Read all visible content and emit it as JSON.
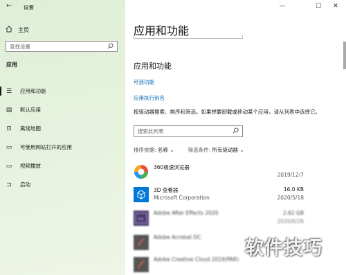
{
  "window": {
    "title": "设置",
    "minimize": "—",
    "maximize": "☐",
    "close": "✕"
  },
  "sidebar": {
    "home_label": "主页",
    "search_placeholder": "查找设置",
    "section_title": "应用",
    "items": [
      {
        "label": "应用和功能",
        "icon": "apps-list-icon"
      },
      {
        "label": "默认应用",
        "icon": "default-apps-icon"
      },
      {
        "label": "离线地图",
        "icon": "offline-map-icon"
      },
      {
        "label": "可使用网站打开的应用",
        "icon": "website-app-icon"
      },
      {
        "label": "视频播放",
        "icon": "video-icon"
      },
      {
        "label": "启动",
        "icon": "startup-icon"
      }
    ]
  },
  "main": {
    "page_title": "应用和功能",
    "section_title": "应用和功能",
    "link_optional": "可选功能",
    "link_aliases": "应用执行别名",
    "description": "按驱动器搜索、排序和筛选。如果想要卸载或移动某个应用，请从列表中选择它。",
    "search_placeholder": "搜索此列表",
    "sort_label": "排序依据:",
    "sort_value": "名称",
    "filter_label": "筛选条件:",
    "filter_value": "所有驱动器"
  },
  "apps": [
    {
      "name": "360极速浏览器",
      "publisher": "",
      "size": "",
      "date": "2019/12/7"
    },
    {
      "name": "3D 查看器",
      "publisher": "Microsoft Corporation",
      "size": "16.0 KB",
      "date": "2020/5/18"
    },
    {
      "name": "Adobe After Effects 2020",
      "publisher": "",
      "size": "2.62 GB",
      "date": "2020/6/26"
    },
    {
      "name": "Adobe Acrobat DC",
      "publisher": "",
      "size": "",
      "date": ""
    },
    {
      "name": "Adobe Creative Cloud 2019(PAR)",
      "publisher": "",
      "size": "",
      "date": ""
    }
  ],
  "watermark": "软件技巧",
  "colors": {
    "accent": "#0063b1",
    "sidebar_bg": "#e3f0da",
    "ae_purple": "#1f0740",
    "adobe_dark": "#2b2b2b"
  }
}
